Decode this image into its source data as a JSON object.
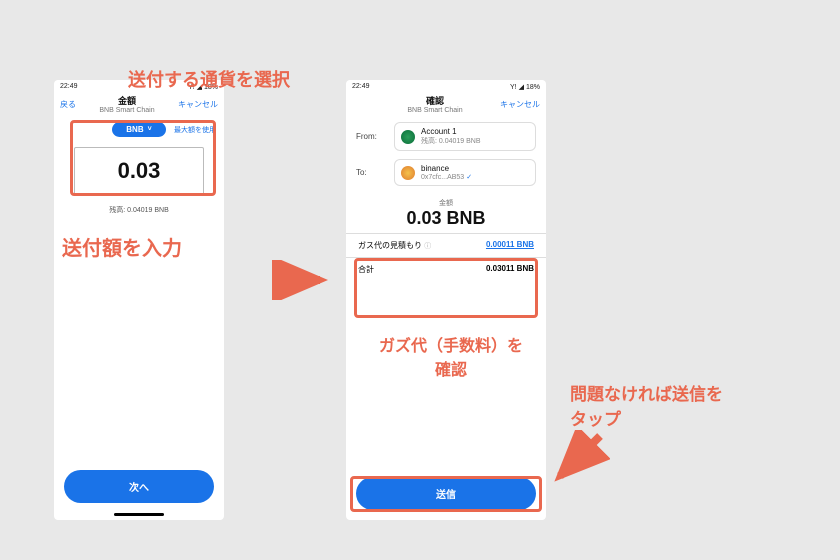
{
  "statusbar": {
    "time": "22:49",
    "network": "Y!",
    "battery": "18%"
  },
  "left": {
    "back": "戻る",
    "title": "金額",
    "subtitle": "BNB Smart Chain",
    "cancel": "キャンセル",
    "currency": "BNB",
    "use_max": "最大額を使用",
    "amount": "0.03",
    "balance": "残高: 0.04019 BNB",
    "next": "次へ"
  },
  "right": {
    "title": "確認",
    "subtitle": "BNB Smart Chain",
    "cancel": "キャンセル",
    "from_label": "From:",
    "from_name": "Account 1",
    "from_sub": "残高: 0.04019 BNB",
    "to_label": "To:",
    "to_name": "binance",
    "to_sub": "0x7cfc...AB53",
    "amount_label": "金額",
    "amount_value": "0.03 BNB",
    "gas_label": "ガス代の見積もり",
    "gas_value": "0.00011 BNB",
    "total_label": "合計",
    "total_value": "0.03011 BNB",
    "send": "送信"
  },
  "annot": {
    "a1": "送付する通貨を選択",
    "a2": "送付額を入力",
    "a3": "ガズ代（手数料）を\n確認",
    "a4": "問題なければ送信を\nタップ"
  },
  "colors": {
    "accent": "#e9684f",
    "primary": "#1a73e8"
  },
  "icons": {
    "chevron_down": "˅",
    "signal": "◢",
    "info": "ⓘ",
    "check": "✓",
    "arrow_right": "→",
    "arrow_down_left": "↙"
  }
}
